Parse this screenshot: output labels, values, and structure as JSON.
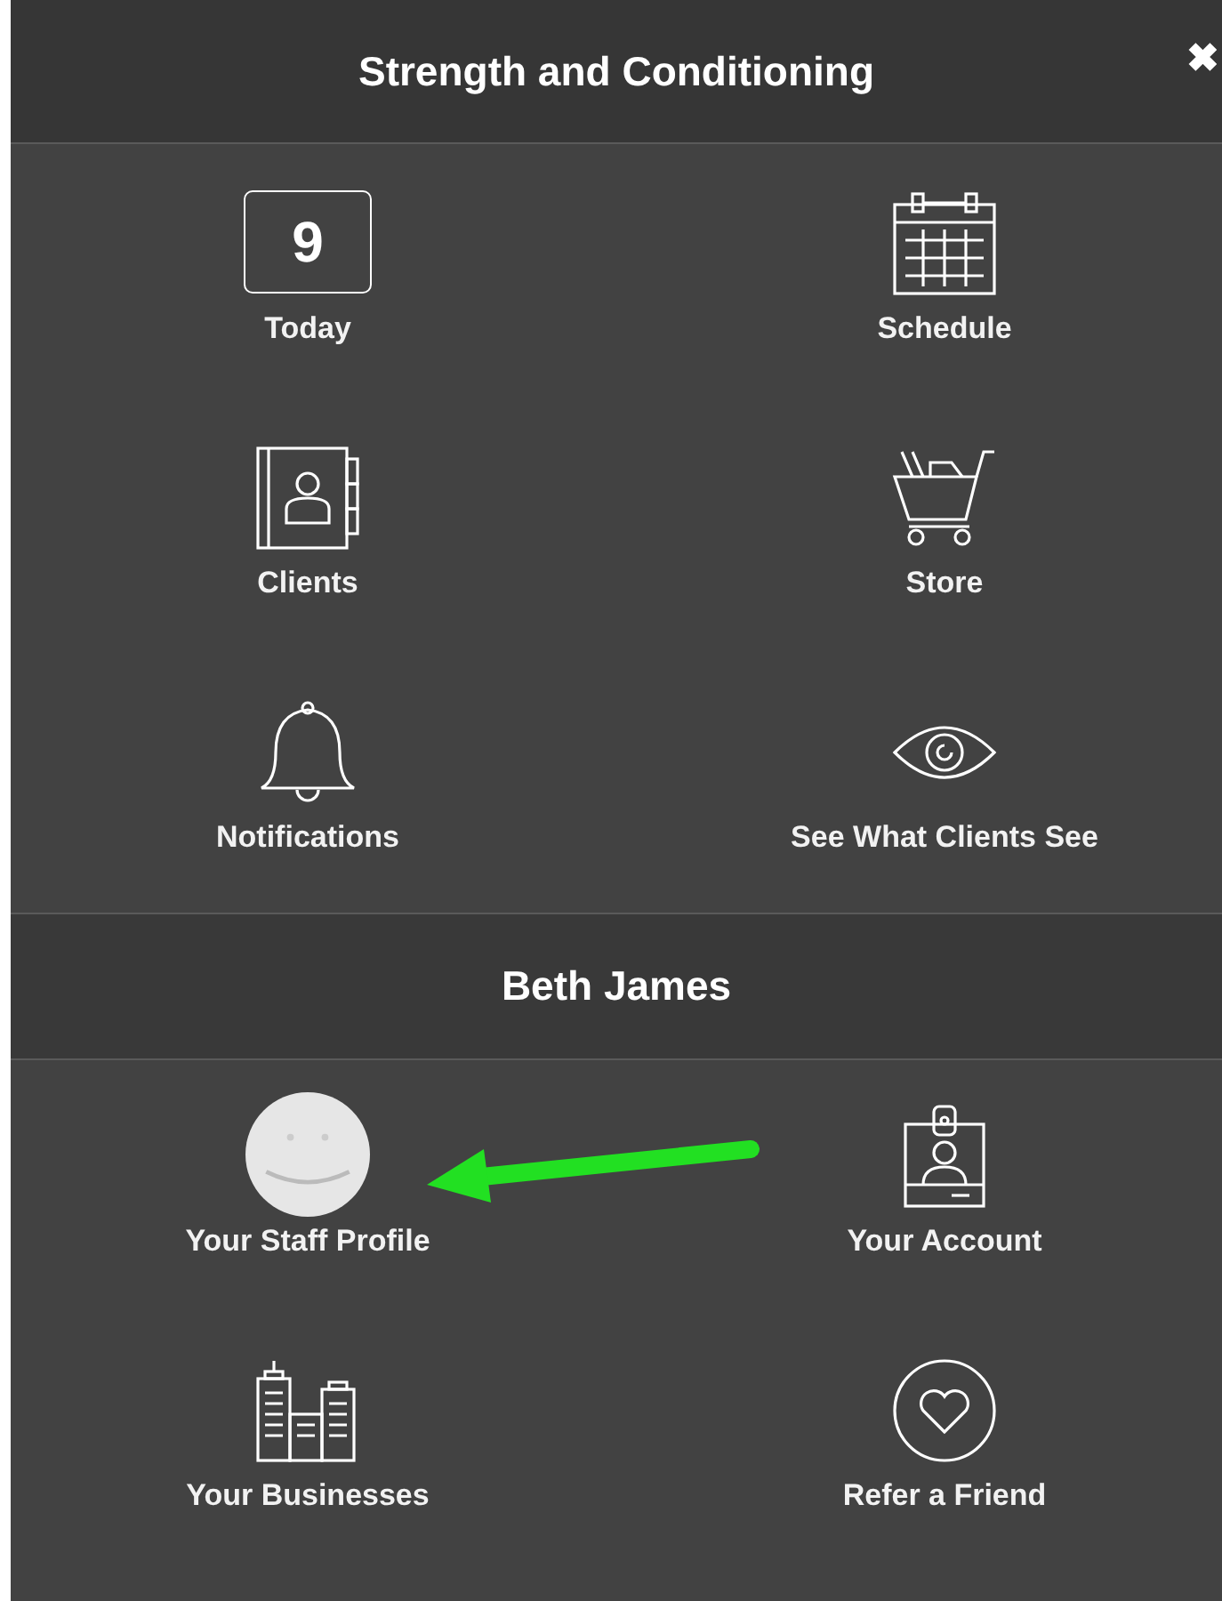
{
  "header": {
    "title": "Strength and Conditioning",
    "close": "✖"
  },
  "menu": [
    {
      "label": "Today",
      "kind": "day",
      "day": "9"
    },
    {
      "label": "Schedule",
      "kind": "calendar"
    },
    {
      "label": "Clients",
      "kind": "contacts"
    },
    {
      "label": "Store",
      "kind": "cart"
    },
    {
      "label": "Notifications",
      "kind": "bell"
    },
    {
      "label": "See What Clients See",
      "kind": "eye"
    }
  ],
  "user": {
    "name": "Beth James"
  },
  "account_menu": [
    {
      "label": "Your Staff Profile",
      "kind": "avatar"
    },
    {
      "label": "Your Account",
      "kind": "badge"
    },
    {
      "label": "Your Businesses",
      "kind": "buildings"
    },
    {
      "label": "Refer a Friend",
      "kind": "heart"
    }
  ]
}
